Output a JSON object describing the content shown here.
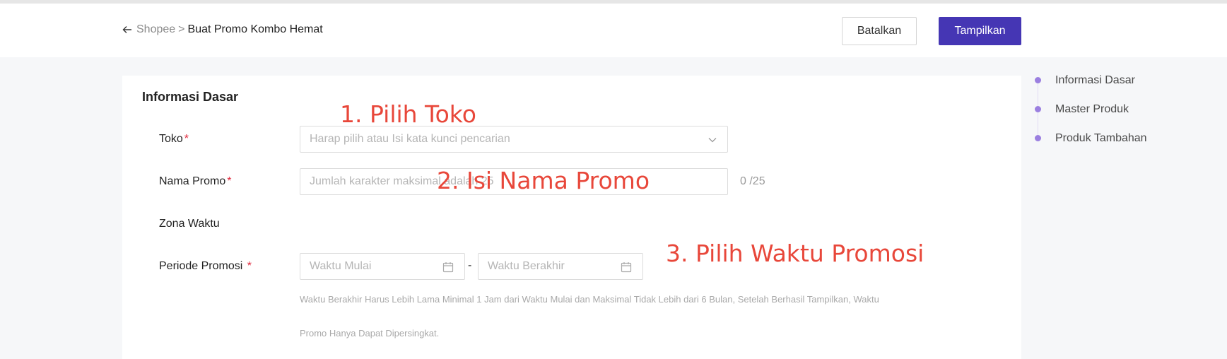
{
  "header": {
    "breadcrumb_link": "Shopee",
    "breadcrumb_sep": ">",
    "breadcrumb_current": "Buat Promo Kombo Hemat",
    "cancel_label": "Batalkan",
    "submit_label": "Tampilkan"
  },
  "form": {
    "section_title": "Informasi Dasar",
    "toko": {
      "label": "Toko",
      "required": "*",
      "placeholder": "Harap pilih atau Isi kata kunci pencarian"
    },
    "nama_promo": {
      "label": "Nama Promo",
      "required": "*",
      "placeholder": "Jumlah karakter maksimal adalah 25",
      "counter": "0 /25"
    },
    "zona_waktu": {
      "label": "Zona Waktu"
    },
    "periode": {
      "label": "Periode Promosi",
      "required": "*",
      "start_placeholder": "Waktu Mulai",
      "separator": "-",
      "end_placeholder": "Waktu Berakhir",
      "hint_line1": "Waktu Berakhir Harus Lebih Lama Minimal 1 Jam dari Waktu Mulai dan Maksimal Tidak Lebih dari 6 Bulan, Setelah Berhasil Tampilkan, Waktu",
      "hint_line2": "Promo Hanya Dapat Dipersingkat."
    }
  },
  "annotations": {
    "step1": "1. Pilih Toko",
    "step2": "2. Isi Nama Promo",
    "step3": "3. Pilih Waktu Promosi"
  },
  "steps_nav": {
    "items": [
      {
        "label": "Informasi Dasar"
      },
      {
        "label": "Master Produk"
      },
      {
        "label": "Produk Tambahan"
      }
    ]
  },
  "colors": {
    "primary": "#4536b4",
    "required": "#e0283c",
    "annotation": "#e8473a",
    "step_dot": "#9b7fe0"
  }
}
